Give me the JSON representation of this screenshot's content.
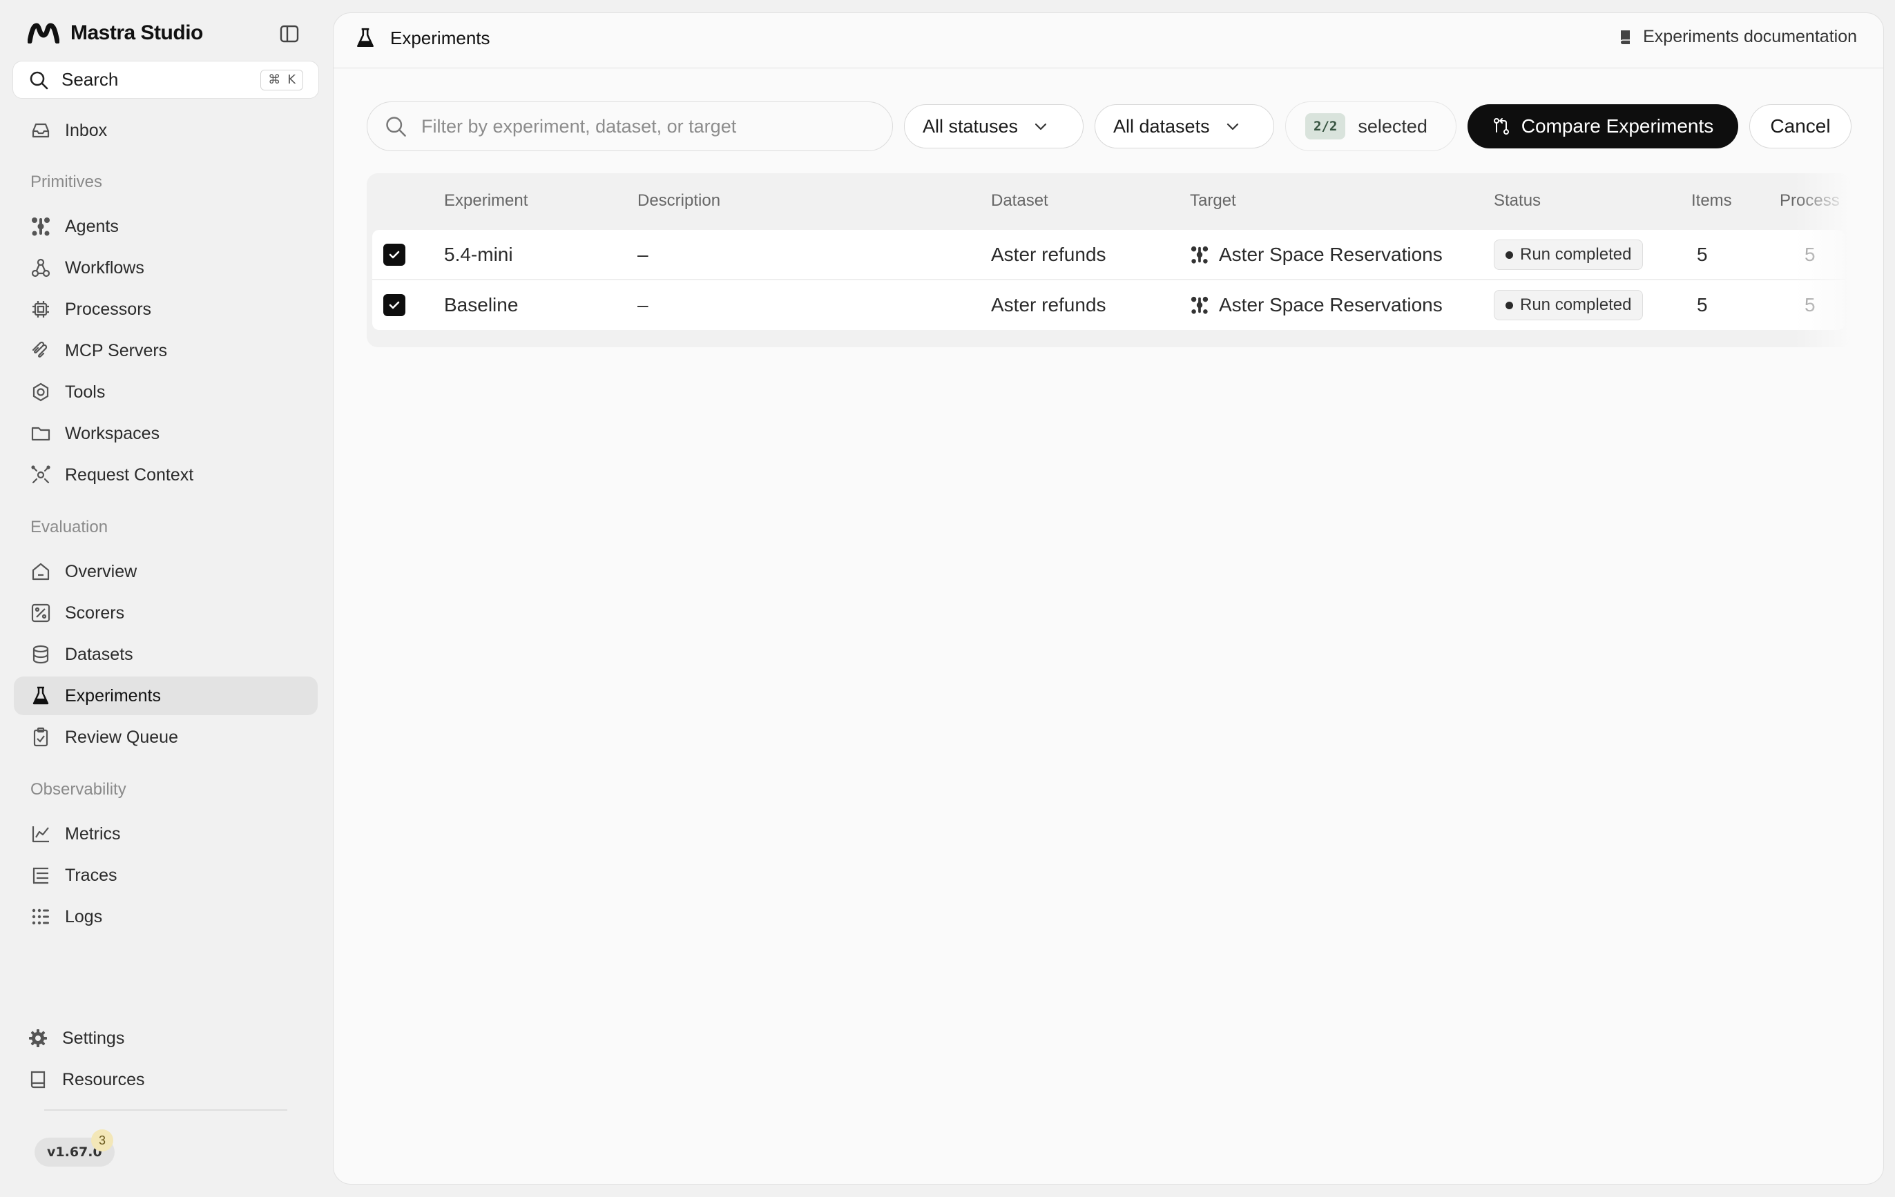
{
  "sidebar": {
    "brand": "Mastra Studio",
    "search": {
      "label": "Search",
      "shortcut_symbol": "⌘",
      "shortcut_key": "K"
    },
    "inbox": "Inbox",
    "sections": {
      "primitives": "Primitives",
      "evaluation": "Evaluation",
      "observability": "Observability"
    },
    "primitives_items": [
      {
        "label": "Agents",
        "icon": "agents-icon"
      },
      {
        "label": "Workflows",
        "icon": "workflows-icon"
      },
      {
        "label": "Processors",
        "icon": "processors-icon"
      },
      {
        "label": "MCP Servers",
        "icon": "mcp-icon"
      },
      {
        "label": "Tools",
        "icon": "tools-icon"
      },
      {
        "label": "Workspaces",
        "icon": "folder-icon"
      },
      {
        "label": "Request Context",
        "icon": "request-context-icon"
      }
    ],
    "evaluation_items": [
      {
        "label": "Overview",
        "icon": "home-icon"
      },
      {
        "label": "Scorers",
        "icon": "percent-icon"
      },
      {
        "label": "Datasets",
        "icon": "database-icon"
      },
      {
        "label": "Experiments",
        "icon": "flask-icon",
        "active": true
      },
      {
        "label": "Review Queue",
        "icon": "clipboard-icon"
      }
    ],
    "observability_items": [
      {
        "label": "Metrics",
        "icon": "chart-icon"
      },
      {
        "label": "Traces",
        "icon": "traces-icon"
      },
      {
        "label": "Logs",
        "icon": "logs-icon"
      }
    ],
    "footer": {
      "settings": "Settings",
      "resources": "Resources",
      "version": "v1.67.0",
      "notification_count": "3"
    }
  },
  "header": {
    "title": "Experiments",
    "docs_link": "Experiments documentation"
  },
  "toolbar": {
    "filter_placeholder": "Filter by experiment, dataset, or target",
    "status_filter": "All statuses",
    "dataset_filter": "All datasets",
    "selected_count": "2/2",
    "selected_label": "selected",
    "compare_label": "Compare Experiments",
    "cancel_label": "Cancel"
  },
  "table": {
    "columns": [
      "Experiment",
      "Description",
      "Dataset",
      "Target",
      "Status",
      "Items",
      "Process"
    ],
    "rows": [
      {
        "experiment": "5.4-mini",
        "description": "–",
        "dataset": "Aster refunds",
        "target": "Aster Space Reservations",
        "status": "Run completed",
        "items": "5",
        "processed": "5",
        "checked": true
      },
      {
        "experiment": "Baseline",
        "description": "–",
        "dataset": "Aster refunds",
        "target": "Aster Space Reservations",
        "status": "Run completed",
        "items": "5",
        "processed": "5",
        "checked": true
      }
    ]
  },
  "colors": {
    "accent": "#0e0e0e",
    "active_nav_bg": "#e3e3e3",
    "selected_chip_bg": "#d9e3dc",
    "notification_badge": "#f3e7b8"
  }
}
